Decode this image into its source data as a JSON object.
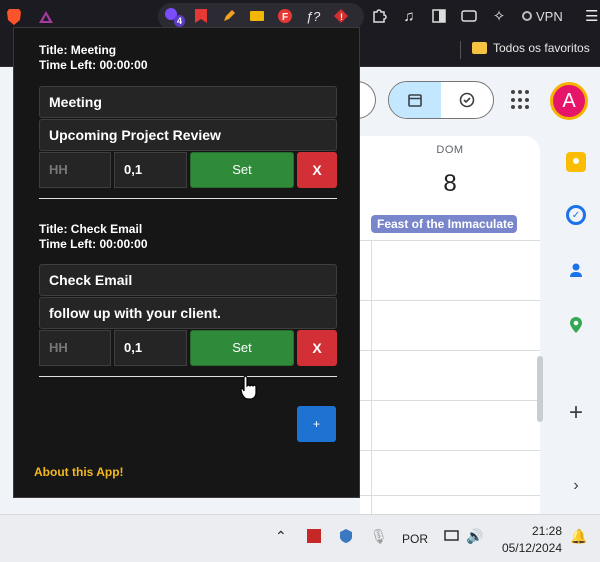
{
  "browser": {
    "bookmarks_folder": "Todos os favoritos",
    "vpn_label": "VPN",
    "extension_badge": "4"
  },
  "calendar": {
    "day_name": "DOM",
    "day_number": "8",
    "holiday_chip": "Feast of the Immaculate",
    "avatar_letter": "A"
  },
  "popup": {
    "tasks": [
      {
        "title_line": "Title: Meeting",
        "time_left_line": "Time Left: 00:00:00",
        "title_value": "Meeting",
        "description": "Upcoming Project Review",
        "hours_placeholder": "HH",
        "minutes_value": "0,1",
        "set_label": "Set",
        "delete_label": "X"
      },
      {
        "title_line": "Title: Check Email",
        "time_left_line": "Time Left: 00:00:00",
        "title_value": "Check Email",
        "description": "follow up with your client.",
        "hours_placeholder": "HH",
        "minutes_value": "0,1",
        "set_label": "Set",
        "delete_label": "X"
      }
    ],
    "add_label": "+",
    "about_link": "About this App!"
  },
  "taskbar": {
    "language": "POR",
    "time": "21:28",
    "date": "05/12/2024"
  },
  "colors": {
    "set_green": "#2f8a3a",
    "delete_red": "#d32f37",
    "add_blue": "#1e73d2",
    "about_yellow": "#f4b81e",
    "holiday_chip": "#7986cb"
  }
}
